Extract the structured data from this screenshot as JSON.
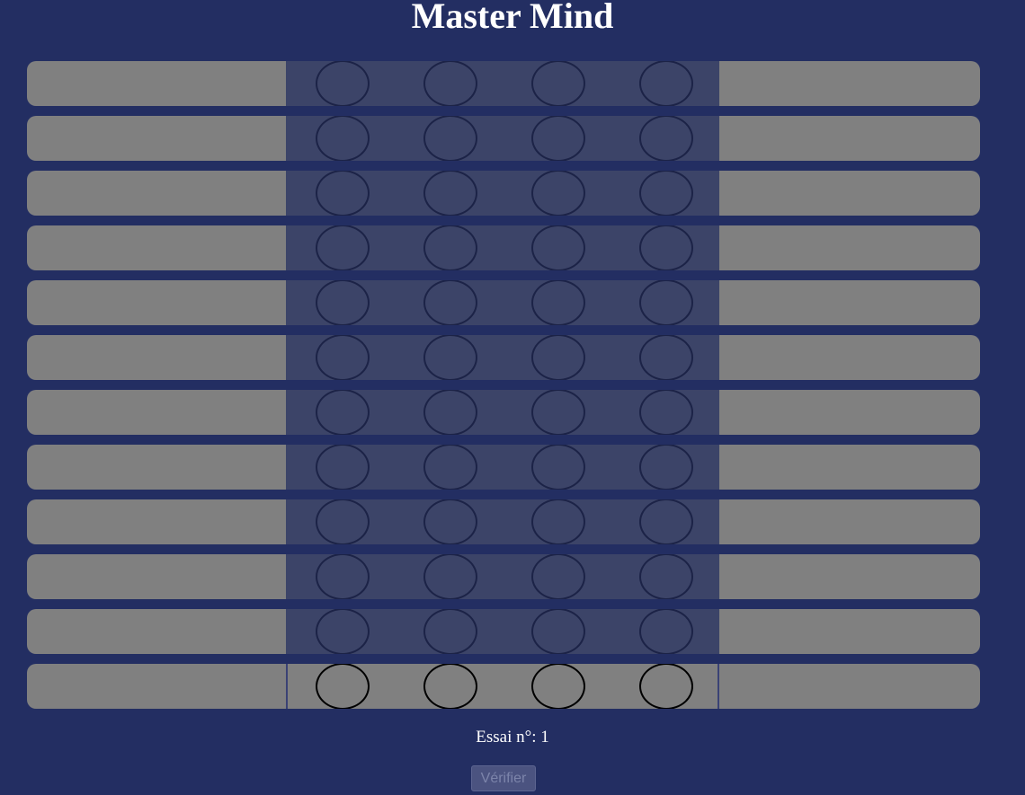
{
  "page": {
    "title": "Master Mind"
  },
  "board": {
    "rows": 12,
    "pegs_per_row": 4,
    "active_row": 12
  },
  "status": {
    "attempt_text": "Essai n°: 1"
  },
  "controls": {
    "verify_label": "Vérifier",
    "verify_enabled": false
  },
  "colors": {
    "background": "#232e62",
    "row_side": "#808080",
    "row_center": "#3c4468",
    "active_center": "#808080",
    "peg_border": "#1c2347",
    "active_peg_border": "#000000"
  }
}
